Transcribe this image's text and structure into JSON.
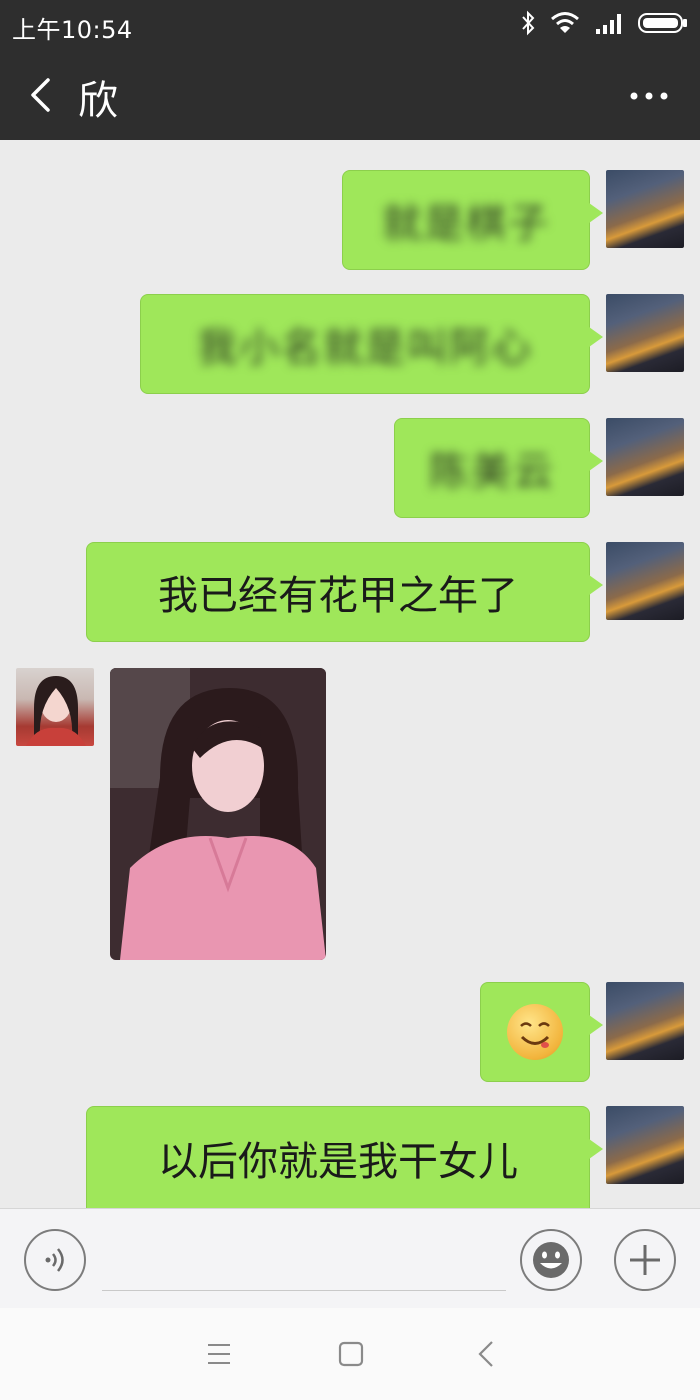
{
  "status_bar": {
    "time": "上午10:54",
    "icons": [
      "bluetooth-icon",
      "wifi-icon",
      "signal-icon",
      "battery-icon"
    ]
  },
  "header": {
    "title": "欣",
    "back_icon": "chevron-left-icon",
    "more_icon": "more-dots-icon"
  },
  "messages": [
    {
      "side": "right",
      "type": "text",
      "text": "就是棋子",
      "blurred": true
    },
    {
      "side": "right",
      "type": "text",
      "text": "我小名就是叫阿心",
      "blurred": true
    },
    {
      "side": "right",
      "type": "text",
      "text": "陈美云",
      "blurred": true
    },
    {
      "side": "right",
      "type": "text",
      "text": "我已经有花甲之年了",
      "blurred": false
    },
    {
      "side": "left",
      "type": "image",
      "description_icon": "photo-icon"
    },
    {
      "side": "right",
      "type": "emoji",
      "emoji": "😋"
    },
    {
      "side": "right",
      "type": "text",
      "text": "以后你就是我干女儿",
      "blurred": false
    }
  ],
  "input_bar": {
    "voice_icon": "voice-icon",
    "emoji_icon": "emoji-icon",
    "plus_icon": "plus-icon",
    "input_value": ""
  },
  "nav_bar": {
    "icons": [
      "menu-icon",
      "home-icon",
      "back-icon"
    ]
  },
  "colors": {
    "header_bg": "#2e2e2e",
    "chat_bg": "#ebebeb",
    "bubble_green": "#9fe75a"
  }
}
